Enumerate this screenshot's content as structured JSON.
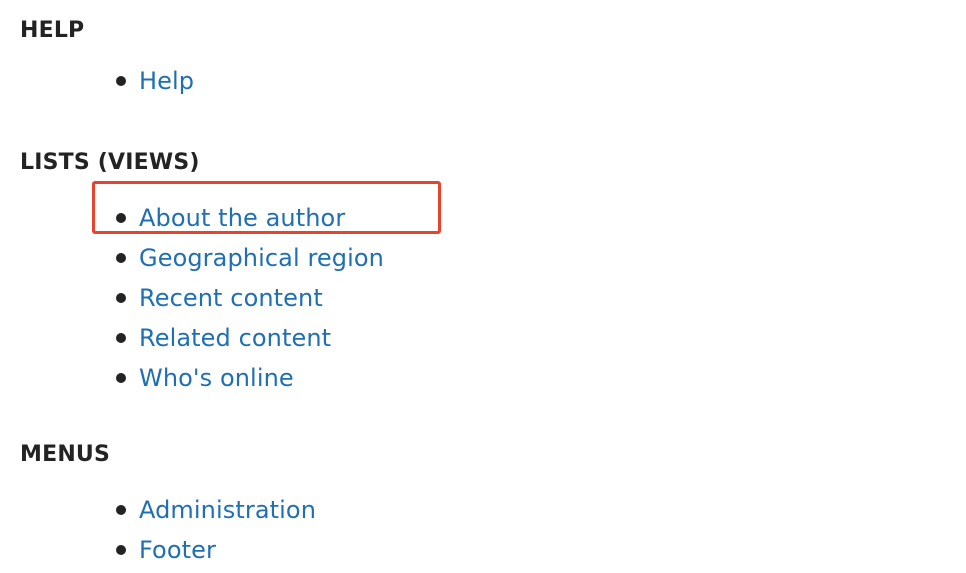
{
  "sections": [
    {
      "title": "HELP",
      "links": [
        "Help"
      ]
    },
    {
      "title": "LISTS (VIEWS)",
      "links": [
        "About the author",
        "Geographical region",
        "Recent content",
        "Related content",
        "Who's online"
      ]
    },
    {
      "title": "MENUS",
      "links": [
        "Administration",
        "Footer"
      ]
    }
  ],
  "highlight_color": "#e8432d",
  "link_color": "#1f6fb2",
  "text_color": "#232323"
}
